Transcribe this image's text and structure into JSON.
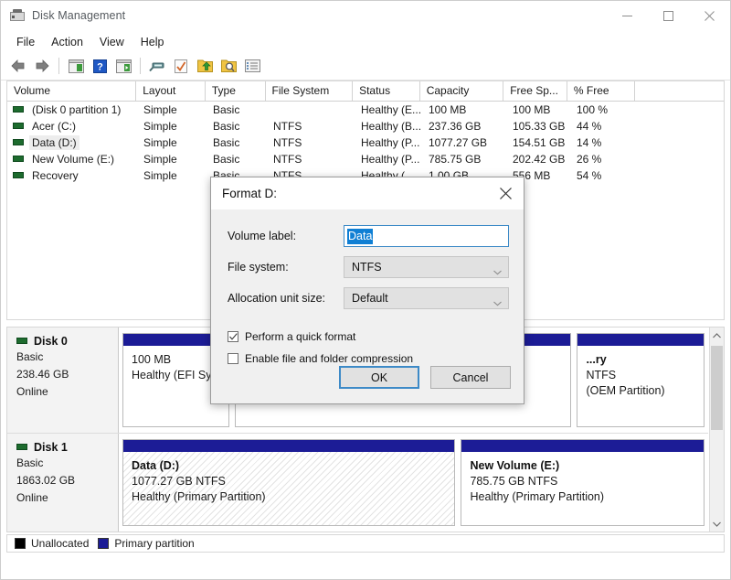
{
  "window": {
    "title": "Disk Management",
    "icon": "disk-management-icon",
    "controls": {
      "minimize": "minimize-icon",
      "maximize": "maximize-icon",
      "close": "close-icon"
    }
  },
  "menubar": {
    "items": [
      "File",
      "Action",
      "View",
      "Help"
    ]
  },
  "toolbar": {
    "items": [
      "back-arrow-icon",
      "forward-arrow-icon",
      "separator",
      "show-hide-console-tree-icon",
      "help-icon",
      "show-hide-action-pane-icon",
      "separator",
      "properties-icon",
      "refresh-icon",
      "rescan-disks-icon",
      "search-icon",
      "list-view-icon"
    ]
  },
  "volume_list": {
    "columns": [
      {
        "label": "Volume",
        "width": 142
      },
      {
        "label": "Layout",
        "width": 76
      },
      {
        "label": "Type",
        "width": 66
      },
      {
        "label": "File System",
        "width": 96
      },
      {
        "label": "Status",
        "width": 74
      },
      {
        "label": "Capacity",
        "width": 92
      },
      {
        "label": "Free Sp...",
        "width": 70
      },
      {
        "label": "% Free",
        "width": 74
      },
      {
        "label": "",
        "width": 98
      }
    ],
    "rows": [
      {
        "volume": "(Disk 0 partition 1)",
        "layout": "Simple",
        "type": "Basic",
        "file_system": "",
        "status": "Healthy (E...",
        "capacity": "100 MB",
        "free_space": "100 MB",
        "percent_free": "100 %",
        "selected": false
      },
      {
        "volume": "Acer (C:)",
        "layout": "Simple",
        "type": "Basic",
        "file_system": "NTFS",
        "status": "Healthy (B...",
        "capacity": "237.36 GB",
        "free_space": "105.33 GB",
        "percent_free": "44 %",
        "selected": false
      },
      {
        "volume": "Data (D:)",
        "layout": "Simple",
        "type": "Basic",
        "file_system": "NTFS",
        "status": "Healthy (P...",
        "capacity": "1077.27 GB",
        "free_space": "154.51 GB",
        "percent_free": "14 %",
        "selected": true
      },
      {
        "volume": "New Volume (E:)",
        "layout": "Simple",
        "type": "Basic",
        "file_system": "NTFS",
        "status": "Healthy (P...",
        "capacity": "785.75 GB",
        "free_space": "202.42 GB",
        "percent_free": "26 %",
        "selected": false
      },
      {
        "volume": "Recovery",
        "layout": "Simple",
        "type": "Basic",
        "file_system": "NTFS",
        "status": "Healthy (...",
        "capacity": "1.00 GB",
        "free_space": "556 MB",
        "percent_free": "54 %",
        "selected": false
      }
    ]
  },
  "disk_pane": {
    "disks": [
      {
        "name": "Disk 0",
        "kind": "Basic",
        "size": "238.46 GB",
        "state": "Online",
        "partitions": [
          {
            "title": "",
            "size_fs": "100 MB",
            "status": "Healthy (EFI Syst",
            "hatched": false,
            "flex": 100
          },
          {
            "title": "",
            "size_fs": "",
            "status": "",
            "hatched": false,
            "flex": 320
          },
          {
            "title": "...ry",
            "size_fs": "NTFS",
            "status": "(OEM Partition)",
            "hatched": false,
            "flex": 120
          }
        ]
      },
      {
        "name": "Disk 1",
        "kind": "Basic",
        "size": "1863.02 GB",
        "state": "Online",
        "partitions": [
          {
            "title": "Data  (D:)",
            "size_fs": "1077.27 GB NTFS",
            "status": "Healthy (Primary Partition)",
            "hatched": true,
            "flex": 1077
          },
          {
            "title": "New Volume  (E:)",
            "size_fs": "785.75 GB NTFS",
            "status": "Healthy (Primary Partition)",
            "hatched": false,
            "flex": 786
          }
        ]
      }
    ],
    "scrollbar": {
      "up": "scroll-up-icon",
      "down": "scroll-down-icon"
    }
  },
  "legend": {
    "items": [
      {
        "label": "Unallocated",
        "color": "#000000"
      },
      {
        "label": "Primary partition",
        "color": "#1c1c96"
      }
    ]
  },
  "dialog": {
    "title": "Format D:",
    "close_icon": "close-icon",
    "fields": {
      "volume_label": {
        "label": "Volume label:",
        "value": "Data",
        "selected": true
      },
      "file_system": {
        "label": "File system:",
        "value": "NTFS"
      },
      "allocation_unit_size": {
        "label": "Allocation unit size:",
        "value": "Default"
      }
    },
    "checkboxes": [
      {
        "label": "Perform a quick format",
        "checked": true
      },
      {
        "label": "Enable file and folder compression",
        "checked": false
      }
    ],
    "buttons": {
      "ok": "OK",
      "cancel": "Cancel"
    }
  }
}
